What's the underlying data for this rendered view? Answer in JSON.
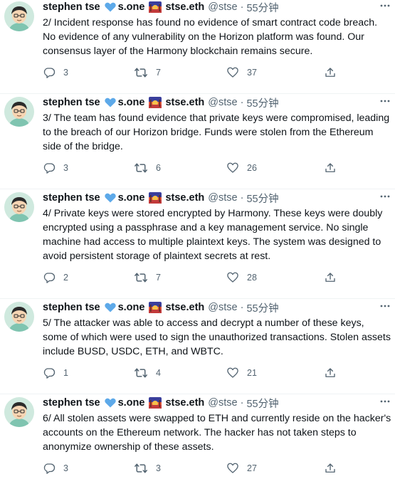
{
  "tweets": [
    {
      "name": "stephen tse",
      "name_suffix": "s.one",
      "ens": "stse.eth",
      "handle": "@stse",
      "sep": "·",
      "time": "55分钟",
      "text": "2/ Incident response has found no evidence of smart contract code breach. No evidence of any vulnerability on the Horizon platform was found. Our consensus layer of the Harmony blockchain remains secure.",
      "replies": "3",
      "retweets": "7",
      "likes": "37"
    },
    {
      "name": "stephen tse",
      "name_suffix": "s.one",
      "ens": "stse.eth",
      "handle": "@stse",
      "sep": "·",
      "time": "55分钟",
      "text": "3/ The team has found evidence that private keys were compromised, leading to the breach of our Horizon bridge. Funds were stolen from the Ethereum side of the bridge.",
      "replies": "3",
      "retweets": "6",
      "likes": "26"
    },
    {
      "name": "stephen tse",
      "name_suffix": "s.one",
      "ens": "stse.eth",
      "handle": "@stse",
      "sep": "·",
      "time": "55分钟",
      "text": "4/ Private keys were stored encrypted by Harmony. These keys were doubly encrypted using a passphrase and a key management service. No single machine had access to multiple plaintext keys. The system was designed to avoid persistent storage of plaintext secrets at rest.",
      "replies": "2",
      "retweets": "7",
      "likes": "28"
    },
    {
      "name": "stephen tse",
      "name_suffix": "s.one",
      "ens": "stse.eth",
      "handle": "@stse",
      "sep": "·",
      "time": "55分钟",
      "text": "5/ The attacker was able to access and decrypt a number of these keys, some of which were used to sign the unauthorized transactions. Stolen assets include BUSD, USDC, ETH, and WBTC.",
      "replies": "1",
      "retweets": "4",
      "likes": "21"
    },
    {
      "name": "stephen tse",
      "name_suffix": "s.one",
      "ens": "stse.eth",
      "handle": "@stse",
      "sep": "·",
      "time": "55分钟",
      "text": "6/ All stolen assets were swapped to ETH and currently reside on the hacker's accounts on the Ethereum network. The hacker has not taken steps to anonymize ownership of these assets.",
      "replies": "3",
      "retweets": "3",
      "likes": "27"
    }
  ],
  "icons": {
    "avatar": "cartoon-avatar-icon",
    "badge": "blue-heart-icon",
    "flag": "sunset-flag-icon",
    "more": "more-icon",
    "reply": "reply-icon",
    "retweet": "retweet-icon",
    "like": "like-icon",
    "share": "share-icon"
  },
  "colors": {
    "text": "#0f1419",
    "muted": "#536471",
    "heart": "#5da9e9",
    "divider": "#eff3f4"
  }
}
